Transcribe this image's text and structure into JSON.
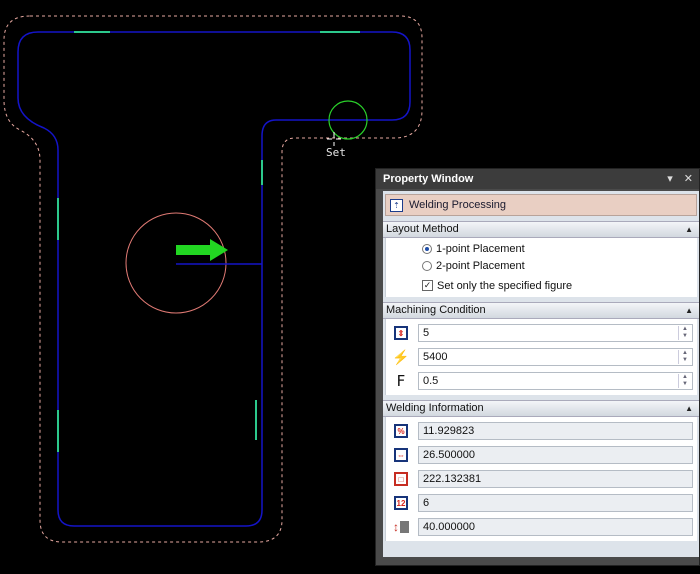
{
  "canvas": {
    "cursor_label": "Set"
  },
  "property_window": {
    "title": "Property Window",
    "pin_glyph": "▾",
    "close_glyph": "✕",
    "process_title": "Welding Processing",
    "process_icon": "welding-processing-icon",
    "sections": {
      "layout_method": {
        "title": "Layout Method",
        "options": [
          "1-point Placement",
          "2-point Placement"
        ],
        "selected": "1-point Placement",
        "checkbox_label": "Set only the specified figure",
        "checkbox_checked": true
      },
      "machining_condition": {
        "title": "Machining Condition",
        "fields": [
          {
            "icon": "power-icon",
            "value": "5"
          },
          {
            "icon": "frequency-icon",
            "value": "5400"
          },
          {
            "icon": "feed-icon",
            "icon_text": "F",
            "value": "0.5"
          }
        ]
      },
      "welding_information": {
        "title": "Welding Information",
        "fields": [
          {
            "icon": "percent-icon",
            "icon_text": "%",
            "value": "11.929823"
          },
          {
            "icon": "length-icon",
            "value": "26.500000"
          },
          {
            "icon": "total-length-icon",
            "value": "222.132381"
          },
          {
            "icon": "count-icon",
            "icon_text": "12",
            "value": "6"
          },
          {
            "icon": "height-icon",
            "value": "40.000000"
          }
        ]
      }
    }
  },
  "colors": {
    "background": "#000000",
    "profile": "#1414c8",
    "offset": "#e6a8a0",
    "marker": "#2cc98c",
    "arrow": "#22d622",
    "circle_large": "#e07a74",
    "circle_small": "#2ad02a"
  }
}
